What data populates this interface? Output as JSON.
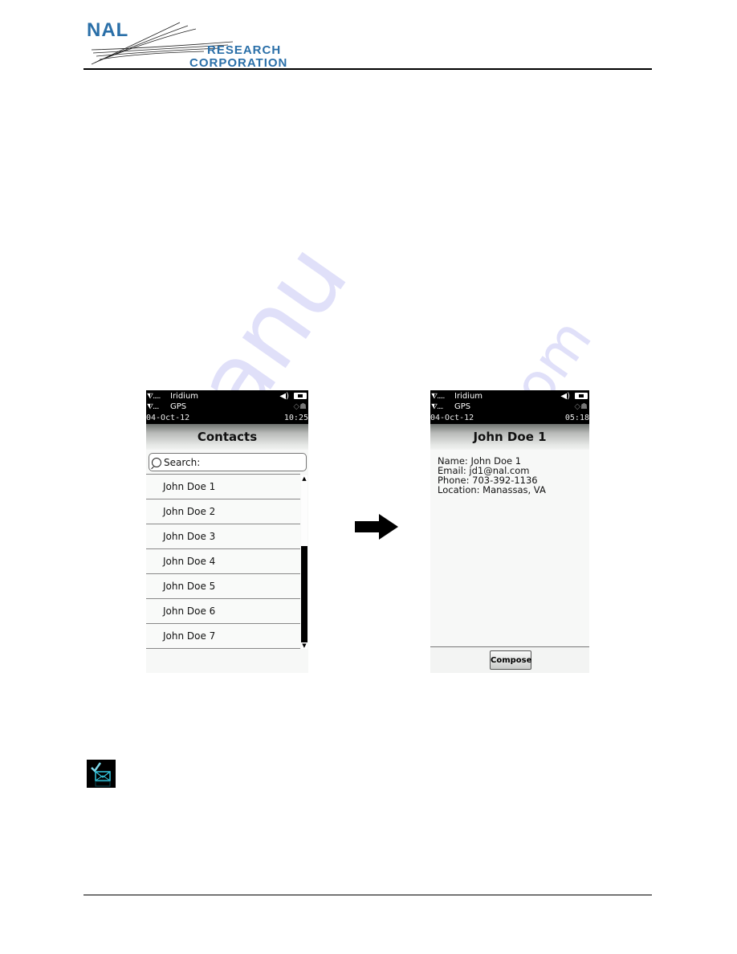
{
  "document": {
    "company_logo": {
      "line1": "NAL",
      "line2": "RESEARCH",
      "line3": "CORPORATION"
    },
    "watermark": {
      "text_main": "manu",
      "text_tail": "com"
    }
  },
  "colors": {
    "brand_blue": "#2a6fa8",
    "status_bar": "#000000",
    "icon_cyan": "#35c8e0"
  },
  "screens": {
    "contacts": {
      "status": {
        "row1_signal": "⧨.....",
        "row1_label": "Iridium",
        "row2_signal": "⧨....",
        "row2_label": "GPS",
        "date": "04-Oct-12",
        "time": "10:25",
        "speaker_icon": "◀)",
        "gps_icons": "◇☗"
      },
      "title": "Contacts",
      "search_placeholder": "Search:",
      "contacts": [
        {
          "name": "John Doe 1"
        },
        {
          "name": "John Doe 2"
        },
        {
          "name": "John Doe 3"
        },
        {
          "name": "John Doe 4"
        },
        {
          "name": "John Doe 5"
        },
        {
          "name": "John Doe 6"
        },
        {
          "name": "John Doe 7"
        }
      ],
      "scrollbar": {
        "up_glyph": "▲",
        "down_glyph": "▼",
        "thumb_start_fraction": 0.4,
        "thumb_end_fraction": 1.0
      }
    },
    "contact_detail": {
      "status": {
        "row1_signal": "⧨.....",
        "row1_label": "Iridium",
        "row2_signal": "⧨....",
        "row2_label": "GPS",
        "date": "04-Oct-12",
        "time": "05:18",
        "speaker_icon": "◀)",
        "gps_icons": "◇☗"
      },
      "title": "John Doe 1",
      "fields": [
        "Name: John Doe 1",
        "Email: jd1@nal.com",
        "Phone: 703-392-1136",
        "Location: Manassas, VA"
      ],
      "compose_label": "Compose"
    }
  },
  "icons": {
    "transition_arrow": "right-arrow",
    "message_icon": "check-envelope"
  }
}
